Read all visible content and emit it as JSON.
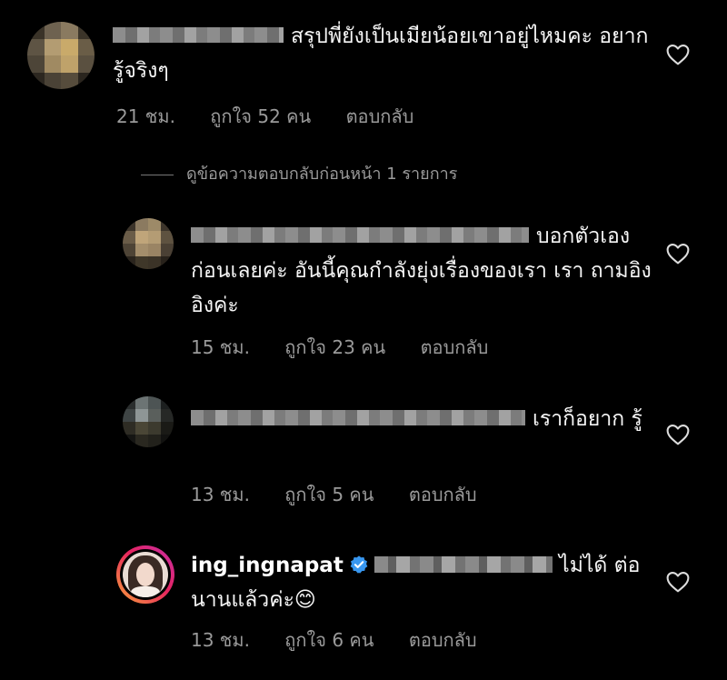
{
  "comments": [
    {
      "text": "สรุปพี่ยังเป็นเมียน้อยเขาอยู่ไหมคะ อยากรู้จริงๆ",
      "time": "21 ชม.",
      "likes": "ถูกใจ 52 คน",
      "reply_label": "ตอบกลับ"
    }
  ],
  "view_previous": "ดูข้อความตอบกลับก่อนหน้า 1 รายการ",
  "replies": [
    {
      "text": "บอกตัวเอง ก่อนเลยค่ะ อันนี้คุณกำลังยุ่งเรื่องของเรา เรา ถามอิงอิงค่ะ",
      "time": "15 ชม.",
      "likes": "ถูกใจ 23 คน",
      "reply_label": "ตอบกลับ"
    },
    {
      "text": "เราก็อยาก รู้",
      "time": "13 ชม.",
      "likes": "ถูกใจ 5 คน",
      "reply_label": "ตอบกลับ"
    },
    {
      "username": "ing_ingnapat",
      "text": "ไม่ได้ ต่อนานแล้วค่ะ😊",
      "time": "13 ชม.",
      "likes": "ถูกใจ 6 คน",
      "reply_label": "ตอบกลับ"
    }
  ],
  "colors": {
    "background": "#000000",
    "meta": "#9a9a9a",
    "verified": "#3897f0"
  }
}
